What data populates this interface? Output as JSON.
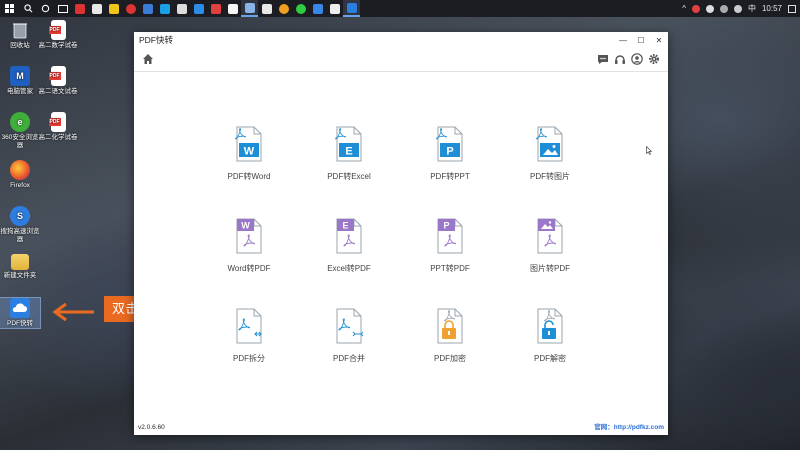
{
  "taskbar": {
    "tray_ime": "中",
    "time": "10:57"
  },
  "desktop": {
    "icons": [
      {
        "label": "回收站",
        "name": "recycle-bin"
      },
      {
        "label": "高二数学试卷",
        "name": "pdf-doc"
      },
      {
        "label": "电脑管家",
        "name": "pc-manager"
      },
      {
        "label": "高二语文试卷",
        "name": "pdf-doc"
      },
      {
        "label": "360安全浏览器",
        "name": "browser-360"
      },
      {
        "label": "高二化学试卷",
        "name": "pdf-doc"
      },
      {
        "label": "Firefox",
        "name": "firefox"
      },
      {
        "label": "搜狗高速浏览器",
        "name": "sogou-browser"
      },
      {
        "label": "新建文件夹",
        "name": "folder"
      },
      {
        "label": "PDF快转",
        "name": "pdf-kuaizhuan"
      }
    ]
  },
  "annotation": {
    "callout": "双击运行【PDF快转】转换器"
  },
  "window": {
    "title": "PDF快转",
    "version": "v2.0.6.60",
    "website": "官网：http://pdfkz.com",
    "tools": [
      {
        "label": "PDF转Word",
        "badge": "W",
        "color": "#1e8fd6",
        "type": "to"
      },
      {
        "label": "PDF转Excel",
        "badge": "E",
        "color": "#1e8fd6",
        "type": "to"
      },
      {
        "label": "PDF转PPT",
        "badge": "P",
        "color": "#1e8fd6",
        "type": "to"
      },
      {
        "label": "PDF转图片",
        "badge": "img",
        "color": "#1e8fd6",
        "type": "to"
      },
      {
        "label": "Word转PDF",
        "badge": "W",
        "color": "#9b77c9",
        "type": "from"
      },
      {
        "label": "Excel转PDF",
        "badge": "E",
        "color": "#9b77c9",
        "type": "from"
      },
      {
        "label": "PPT转PDF",
        "badge": "P",
        "color": "#9b77c9",
        "type": "from"
      },
      {
        "label": "图片转PDF",
        "badge": "img",
        "color": "#9b77c9",
        "type": "from"
      },
      {
        "label": "PDF拆分",
        "badge": "split",
        "color": "#1e8fd6",
        "type": "split"
      },
      {
        "label": "PDF合并",
        "badge": "merge",
        "color": "#1e8fd6",
        "type": "merge"
      },
      {
        "label": "PDF加密",
        "badge": "lock",
        "color": "#f0a030",
        "type": "lock"
      },
      {
        "label": "PDF解密",
        "badge": "unlock",
        "color": "#1e8fd6",
        "type": "unlock"
      }
    ]
  },
  "colors": {
    "accent_blue": "#1e8fd6",
    "accent_purple": "#9b77c9",
    "accent_orange": "#ea6a22",
    "lock_orange": "#f0a030"
  }
}
